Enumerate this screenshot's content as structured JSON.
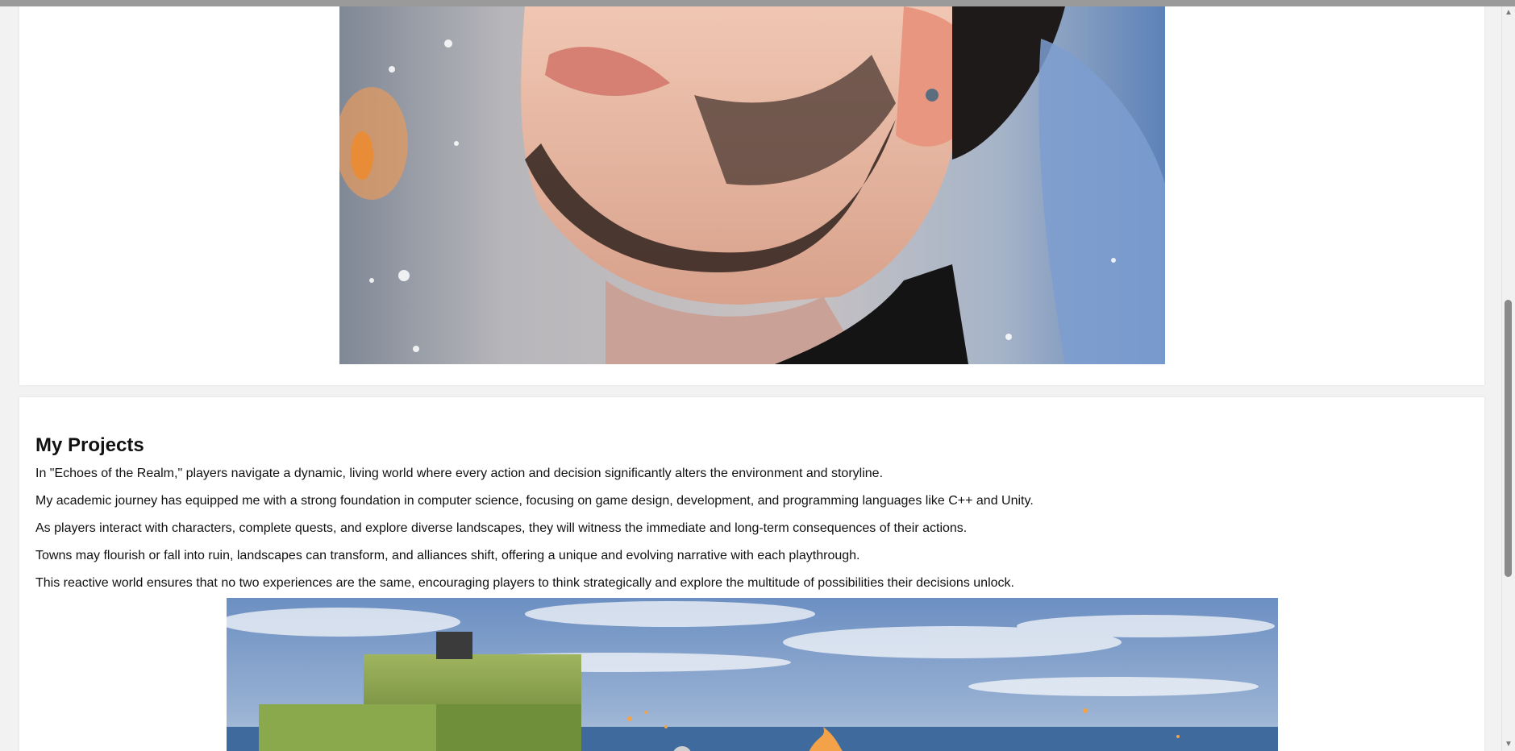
{
  "profile": {
    "portrait_alt": "Portrait of a bearded man with an earring"
  },
  "projects": {
    "title": "My Projects",
    "paragraphs": [
      "In \"Echoes of the Realm,\" players navigate a dynamic, living world where every action and decision significantly alters the environment and storyline.",
      "My academic journey has equipped me with a strong foundation in computer science, focusing on game design, development, and programming languages like C++ and Unity.",
      "As players interact with characters, complete quests, and explore diverse landscapes, they will witness the immediate and long-term consequences of their actions.",
      "Towns may flourish or fall into ruin, landscapes can transform, and alliances shift, offering a unique and evolving narrative with each playthrough.",
      "This reactive world ensures that no two experiences are the same, encouraging players to think strategically and explore the multitude of possibilities their decisions unlock."
    ]
  },
  "scrollbar": {
    "up_icon": "triangle-up",
    "down_icon": "triangle-down",
    "thumb_position_fraction": 0.42
  },
  "colors": {
    "page_background": "#f2f2f2",
    "card_background": "#ffffff",
    "text": "#111111"
  }
}
